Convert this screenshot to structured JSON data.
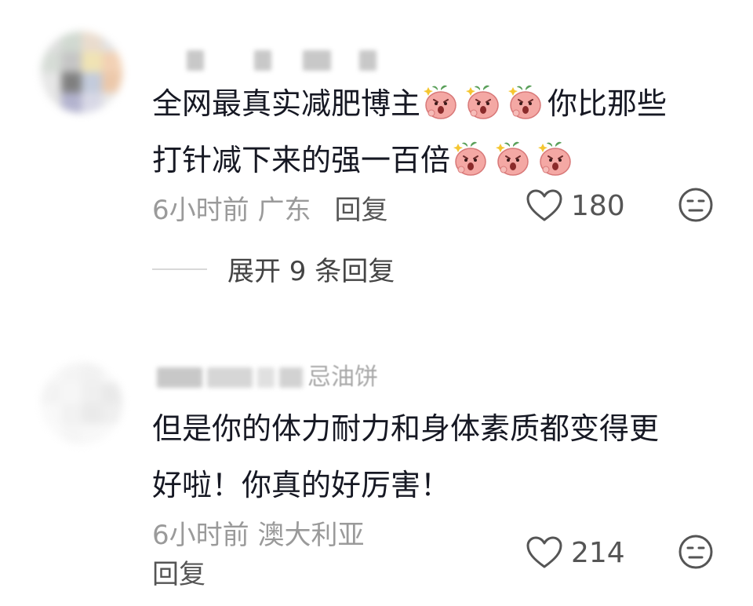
{
  "comments": [
    {
      "text_line1": "全网最真实减肥博主",
      "text_line1_tail": "你比那些",
      "text_line2": "打针减下来的强一百倍",
      "time_location": "6小时前 广东",
      "reply_label": "回复",
      "likes": "180",
      "expand_replies": "展开 9 条回复",
      "emoji_name": "angry-peach-emoji"
    },
    {
      "name_visible_tail": "忌油饼",
      "text_line1": "但是你的体力耐力和身体素质都变得更",
      "text_line2": "好啦！你真的好厉害！",
      "time_location": "6小时前 澳大利亚",
      "reply_label": "回复",
      "likes": "214"
    }
  ],
  "icons": {
    "like": "heart-outline-icon",
    "dislike": "unamused-face-icon"
  },
  "colors": {
    "text": "#161823",
    "meta": "#9a9a9a",
    "action": "#555555"
  }
}
